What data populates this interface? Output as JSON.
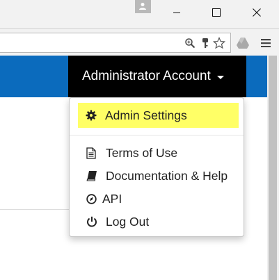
{
  "browser": {
    "window_controls": {
      "profile_icon": "person-icon",
      "minimize_icon": "minimize-icon",
      "maximize_icon": "maximize-icon",
      "close_icon": "close-icon"
    },
    "toolbar_icons": [
      "zoom-icon",
      "key-icon",
      "bookmark-star-icon",
      "drive-icon",
      "menu-icon"
    ]
  },
  "navbar": {
    "account_label": "Administrator Account",
    "bar_color": "#0b6bbd"
  },
  "dropdown": {
    "items": [
      {
        "label": "Admin Settings",
        "icon": "gear-icon",
        "highlighted": true,
        "highlight_color": "#ffff66"
      },
      {
        "label": "Terms of Use",
        "icon": "document-icon"
      },
      {
        "label": "Documentation & Help",
        "icon": "book-icon"
      },
      {
        "label": "API",
        "icon": "compass-icon"
      },
      {
        "label": "Log Out",
        "icon": "power-icon"
      }
    ]
  }
}
